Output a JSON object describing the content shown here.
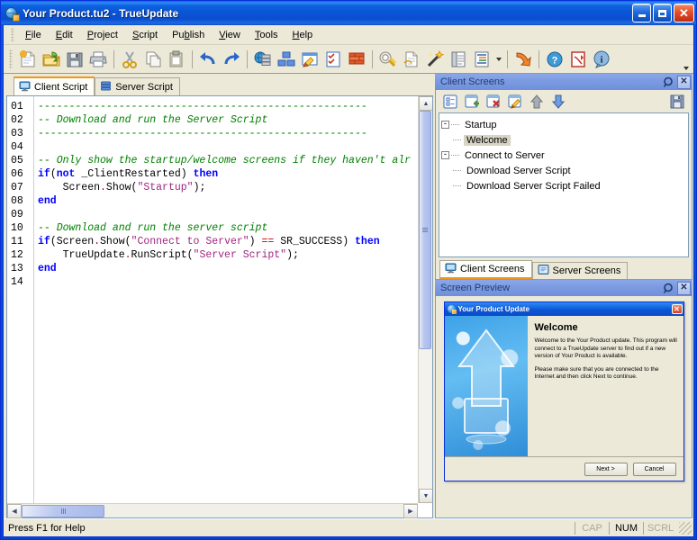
{
  "window": {
    "title": "Your Product.tu2 - TrueUpdate",
    "icon": "globe-update-icon",
    "minimize_label": "_",
    "maximize_label": "□",
    "close_label": "✕"
  },
  "menu": {
    "items": [
      {
        "label": "File",
        "accel": "F"
      },
      {
        "label": "Edit",
        "accel": "E"
      },
      {
        "label": "Project",
        "accel": "P"
      },
      {
        "label": "Script",
        "accel": "S"
      },
      {
        "label": "Publish",
        "accel": "b"
      },
      {
        "label": "View",
        "accel": "V"
      },
      {
        "label": "Tools",
        "accel": "T"
      },
      {
        "label": "Help",
        "accel": "H"
      }
    ]
  },
  "toolbar": {
    "groups": [
      [
        "new-project-icon",
        "open-project-icon",
        "save-project-icon",
        "print-icon"
      ],
      [
        "cut-icon",
        "copy-icon",
        "paste-icon"
      ],
      [
        "undo-icon",
        "redo-icon"
      ],
      [
        "server-globe-icon",
        "build-blocks-icon",
        "screen-design-icon",
        "check-list-icon",
        "firewall-icon"
      ],
      [
        "plug-icon",
        "document-icon",
        "wizard-wand-icon",
        "properties-icon",
        "outline-list-icon"
      ],
      [
        "publish-arrow-icon"
      ],
      [
        "help-icon",
        "pdf-manual-icon",
        "about-info-icon"
      ]
    ],
    "overflow_label": "▼"
  },
  "editor": {
    "tabs": [
      {
        "label": "Client Script",
        "icon": "monitor-icon",
        "active": true
      },
      {
        "label": "Server Script",
        "icon": "database-icon",
        "active": false
      }
    ],
    "line_numbers": [
      "01",
      "02",
      "03",
      "04",
      "05",
      "06",
      "07",
      "08",
      "09",
      "10",
      "11",
      "12",
      "13",
      "14"
    ],
    "lines": [
      {
        "num": "01",
        "segments": [
          {
            "t": "-----------------------------------------------------",
            "c": "cm"
          }
        ]
      },
      {
        "num": "02",
        "segments": [
          {
            "t": "-- Download and run the Server Script",
            "c": "cm"
          }
        ]
      },
      {
        "num": "03",
        "segments": [
          {
            "t": "-----------------------------------------------------",
            "c": "cm"
          }
        ]
      },
      {
        "num": "04",
        "segments": []
      },
      {
        "num": "05",
        "segments": [
          {
            "t": "-- Only show the startup/welcome screens if they haven't alr",
            "c": "cm"
          }
        ]
      },
      {
        "num": "06",
        "segments": [
          {
            "t": "if",
            "c": "kw"
          },
          {
            "t": "(",
            "c": "pl"
          },
          {
            "t": "not",
            "c": "kw"
          },
          {
            "t": " _ClientRestarted) ",
            "c": "pl"
          },
          {
            "t": "then",
            "c": "kw"
          }
        ]
      },
      {
        "num": "07",
        "segments": [
          {
            "t": "    Screen",
            "c": "pl"
          },
          {
            "t": ".",
            "c": "op"
          },
          {
            "t": "Show(",
            "c": "pl"
          },
          {
            "t": "\"Startup\"",
            "c": "str"
          },
          {
            "t": ");",
            "c": "pl"
          }
        ]
      },
      {
        "num": "08",
        "segments": [
          {
            "t": "end",
            "c": "kw"
          }
        ]
      },
      {
        "num": "09",
        "segments": []
      },
      {
        "num": "10",
        "segments": [
          {
            "t": "-- Download and run the server script",
            "c": "cm"
          }
        ]
      },
      {
        "num": "11",
        "segments": [
          {
            "t": "if",
            "c": "kw"
          },
          {
            "t": "(Screen",
            "c": "pl"
          },
          {
            "t": ".",
            "c": "op"
          },
          {
            "t": "Show(",
            "c": "pl"
          },
          {
            "t": "\"Connect to Server\"",
            "c": "str"
          },
          {
            "t": ") ",
            "c": "pl"
          },
          {
            "t": "==",
            "c": "op"
          },
          {
            "t": " SR_SUCCESS) ",
            "c": "pl"
          },
          {
            "t": "then",
            "c": "kw"
          }
        ]
      },
      {
        "num": "12",
        "segments": [
          {
            "t": "    TrueUpdate",
            "c": "pl"
          },
          {
            "t": ".",
            "c": "op"
          },
          {
            "t": "RunScript(",
            "c": "pl"
          },
          {
            "t": "\"Server Script\"",
            "c": "str"
          },
          {
            "t": ");",
            "c": "pl"
          }
        ]
      },
      {
        "num": "13",
        "segments": [
          {
            "t": "end",
            "c": "kw"
          }
        ]
      },
      {
        "num": "14",
        "segments": []
      }
    ]
  },
  "client_screens_panel": {
    "title": "Client Screens",
    "title_buttons": [
      {
        "name": "auto-hide-pin-icon",
        "label": "◐"
      },
      {
        "name": "close-panel-icon",
        "label": "✕"
      }
    ],
    "toolbar_icons": [
      "screen-properties-icon",
      "add-screen-icon",
      "delete-screen-icon",
      "edit-screen-icon",
      "move-up-icon",
      "move-down-icon",
      "save-screens-icon"
    ],
    "tree": [
      {
        "label": "Startup",
        "level": 0,
        "expander": "-",
        "selected": false
      },
      {
        "label": "Welcome",
        "level": 1,
        "expander": "",
        "selected": true
      },
      {
        "label": "Connect to Server",
        "level": 0,
        "expander": "-",
        "selected": false
      },
      {
        "label": "Download Server Script",
        "level": 1,
        "expander": "",
        "selected": false
      },
      {
        "label": "Download Server Script Failed",
        "level": 1,
        "expander": "",
        "selected": false
      }
    ],
    "tabs": [
      {
        "label": "Client Screens",
        "icon": "client-screen-icon",
        "active": true
      },
      {
        "label": "Server Screens",
        "icon": "server-screen-icon",
        "active": false
      }
    ]
  },
  "screen_preview_panel": {
    "title": "Screen Preview",
    "title_buttons": [
      {
        "name": "auto-hide-pin-icon",
        "label": "◐"
      },
      {
        "name": "close-panel-icon",
        "label": "✕"
      }
    ],
    "preview": {
      "window_title": "Your Product Update",
      "window_icon": "product-update-icon",
      "close_label": "✕",
      "graphic": "blue-update-arrow-monitor-graphic",
      "heading": "Welcome",
      "paragraph1": "Welcome to the Your Product update. This program will connect to a TrueUpdate server to find out if a new version of Your Product is available.",
      "paragraph2": "Please make sure that you are connected to the Internet and then click Next to continue.",
      "buttons": [
        {
          "label": "Next >",
          "name": "next-button"
        },
        {
          "label": "Cancel",
          "name": "cancel-button"
        }
      ]
    }
  },
  "statusbar": {
    "message": "Press F1 for Help",
    "indicators": [
      {
        "label": "CAP",
        "active": false
      },
      {
        "label": "NUM",
        "active": true
      },
      {
        "label": "SCRL",
        "active": false
      }
    ]
  },
  "scrollbars": {
    "up_arrow": "▲",
    "down_arrow": "▼",
    "left_arrow": "◀",
    "right_arrow": "▶"
  }
}
